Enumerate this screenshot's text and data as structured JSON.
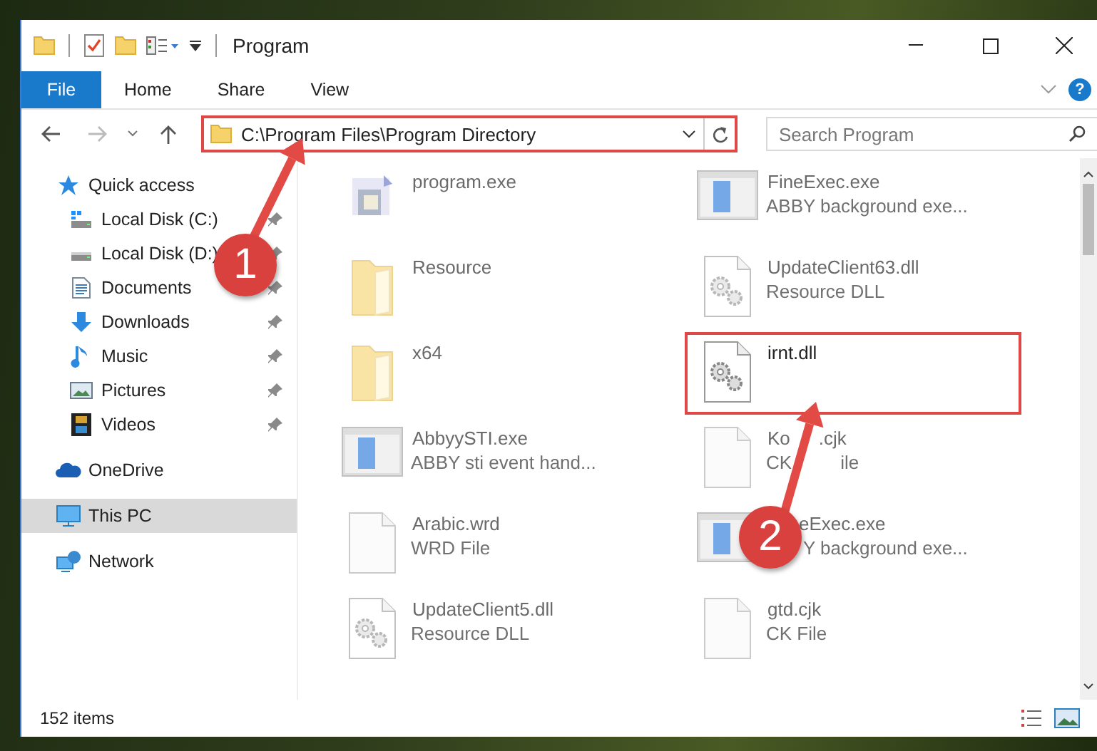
{
  "window": {
    "title": "Program"
  },
  "ribbon": {
    "tabs": [
      {
        "label": "File",
        "kind": "file"
      },
      {
        "label": "Home",
        "kind": "tab"
      },
      {
        "label": "Share",
        "kind": "tab"
      },
      {
        "label": "View",
        "kind": "tab"
      }
    ],
    "help": "?"
  },
  "address": {
    "path": "C:\\Program Files\\Program Directory",
    "highlighted": true
  },
  "search": {
    "placeholder": "Search Program"
  },
  "sidebar": {
    "items": [
      {
        "label": "Quick access",
        "kind": "star",
        "selected": false,
        "children": [
          {
            "label": "Local Disk (C:)",
            "kind": "system-drive",
            "pinned": true,
            "selected": false
          },
          {
            "label": "Local Disk (D:)",
            "kind": "drive",
            "pinned": true,
            "selected": false
          },
          {
            "label": "Documents",
            "kind": "documents",
            "pinned": true,
            "selected": false
          },
          {
            "label": "Downloads",
            "kind": "downloads",
            "pinned": true,
            "selected": false
          },
          {
            "label": "Music",
            "kind": "music",
            "pinned": true,
            "selected": false
          },
          {
            "label": "Pictures",
            "kind": "pictures",
            "pinned": true,
            "selected": false
          },
          {
            "label": "Videos",
            "kind": "videos",
            "pinned": true,
            "selected": false
          }
        ]
      },
      {
        "label": "OneDrive",
        "kind": "cloud",
        "selected": false
      },
      {
        "label": "This PC",
        "kind": "pc",
        "selected": true
      },
      {
        "label": "Network",
        "kind": "network",
        "selected": false
      }
    ]
  },
  "files": {
    "items": [
      {
        "name": "program.exe",
        "kind": "installer",
        "blurred": true,
        "highlighted": false
      },
      {
        "name": "FineExec.exe",
        "type": "ABBY background exe...",
        "kind": "app",
        "blurred": true,
        "highlighted": false
      },
      {
        "name": "Resource",
        "kind": "folder",
        "blurred": true,
        "highlighted": false
      },
      {
        "name": "UpdateClient63.dll",
        "type": "Resource DLL",
        "kind": "dll",
        "blurred": true,
        "highlighted": false
      },
      {
        "name": "x64",
        "kind": "folder",
        "blurred": true,
        "highlighted": false
      },
      {
        "name": "irnt.dll",
        "kind": "dll",
        "blurred": false,
        "highlighted": true
      },
      {
        "name": "AbbyySTI.exe",
        "type": "ABBY sti event hand...",
        "kind": "app",
        "blurred": true,
        "highlighted": false
      },
      {
        "name": "Ko",
        "name_tail": ".cjk",
        "type": "CK",
        "type_tail": "ile",
        "kind": "page",
        "blurred": true,
        "highlighted": false
      },
      {
        "name": "Arabic.wrd",
        "type": "WRD File",
        "kind": "page",
        "blurred": true,
        "highlighted": false
      },
      {
        "name": "eExec.exe",
        "type": "Y background exe...",
        "kind": "app",
        "covered": true,
        "blurred": true,
        "highlighted": false
      },
      {
        "name": "UpdateClient5.dll",
        "type": "Resource DLL",
        "kind": "dll",
        "blurred": true,
        "highlighted": false
      },
      {
        "name": "gtd.cjk",
        "type": "CK File",
        "kind": "page",
        "blurred": true,
        "highlighted": false
      }
    ]
  },
  "status_bar": {
    "count": "152 items"
  },
  "annotations": [
    {
      "label": "1"
    },
    {
      "label": "2"
    }
  ]
}
